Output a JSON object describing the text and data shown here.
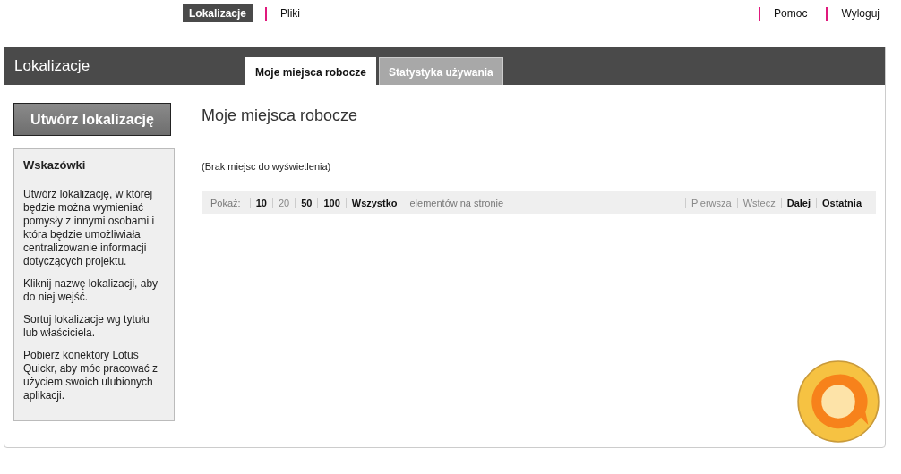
{
  "top_nav": {
    "left": [
      {
        "label": "Lokalizacje",
        "selected": true
      },
      {
        "label": "Pliki",
        "selected": false
      }
    ],
    "right": [
      "Pomoc",
      "Wyloguj"
    ]
  },
  "header": {
    "title": "Lokalizacje",
    "tabs": [
      {
        "label": "Moje miejsca robocze",
        "selected": true
      },
      {
        "label": "Statystyka używania",
        "selected": false
      }
    ]
  },
  "sidebar": {
    "create_button": "Utwórz lokalizację",
    "tips": {
      "title": "Wskazówki",
      "paragraphs": [
        "Utwórz lokalizację, w której będzie można wymieniać pomysły z innymi osobami i która będzie umożliwiała centralizowanie informacji dotyczących projektu.",
        "Kliknij nazwę lokalizacji, aby do niej wejść.",
        "Sortuj lokalizacje wg tytułu lub właściciela.",
        "Pobierz konektory Lotus Quickr, aby móc pracować z użyciem swoich ulubionych aplikacji."
      ]
    }
  },
  "main": {
    "title": "Moje miejsca robocze",
    "empty_message": "(Brak miejsc do wyświetlenia)",
    "pager": {
      "show_label": "Pokaż:",
      "sizes": [
        {
          "label": "10",
          "selected": false
        },
        {
          "label": "20",
          "selected": true
        },
        {
          "label": "50",
          "selected": false
        },
        {
          "label": "100",
          "selected": false
        },
        {
          "label": "Wszystko",
          "selected": false
        }
      ],
      "per_page_label": "elementów na stronie",
      "nav": [
        {
          "label": "Pierwsza",
          "disabled": true
        },
        {
          "label": "Wstecz",
          "disabled": true
        },
        {
          "label": "Dalej",
          "disabled": false
        },
        {
          "label": "Ostatnia",
          "disabled": false
        }
      ]
    }
  }
}
